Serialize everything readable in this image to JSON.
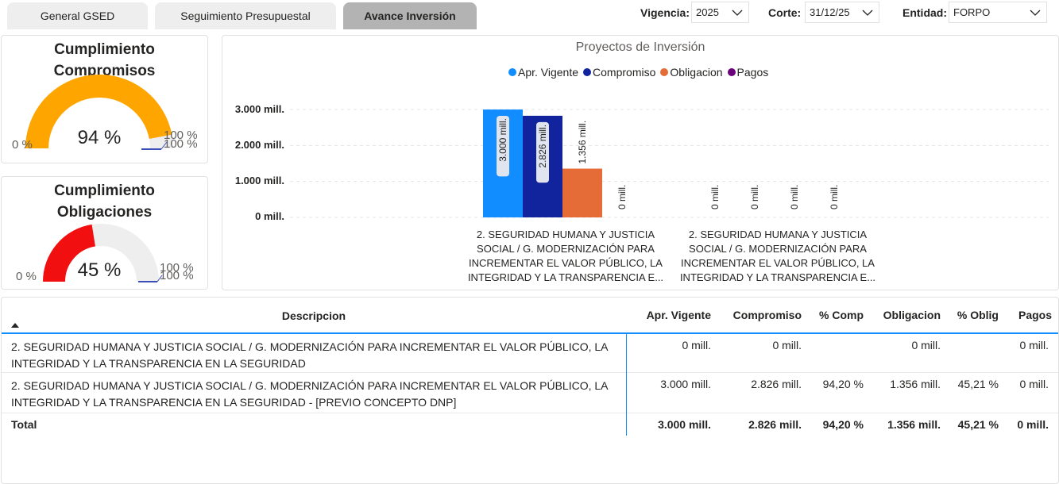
{
  "tabs": [
    {
      "label": "General GSED"
    },
    {
      "label": "Seguimiento Presupuestal"
    },
    {
      "label": "Avance Inversión"
    }
  ],
  "filters": {
    "vigencia": {
      "label": "Vigencia:",
      "value": "2025"
    },
    "corte": {
      "label": "Corte:",
      "value": "31/12/25"
    },
    "entidad": {
      "label": "Entidad:",
      "value": "FORPO"
    }
  },
  "gauges": [
    {
      "title_line1": "Cumplimiento",
      "title_line2": "Compromisos",
      "value_text": "94 %",
      "value": 0.94,
      "min_label": "0 %",
      "max_label": "100 %",
      "target_label": "100 %",
      "fill_color": "#FFA500"
    },
    {
      "title_line1": "Cumplimiento",
      "title_line2": "Obligaciones",
      "value_text": "45 %",
      "value": 0.45,
      "min_label": "0 %",
      "max_label": "100 %",
      "target_label": "100 %",
      "fill_color": "#F20F0F"
    }
  ],
  "chart_data": {
    "type": "bar",
    "title": "Proyectos de Inversión",
    "legend_position": "top-center",
    "grid": true,
    "ylim": [
      0,
      3000
    ],
    "yticks": [
      {
        "value": 0,
        "label": "0 mill."
      },
      {
        "value": 1000,
        "label": "1.000 mill."
      },
      {
        "value": 2000,
        "label": "2.000 mill."
      },
      {
        "value": 3000,
        "label": "3.000 mill."
      }
    ],
    "categories": [
      "2. SEGURIDAD HUMANA Y JUSTICIA SOCIAL / G. MODERNIZACIÓN PARA INCREMENTAR EL VALOR PÚBLICO, LA INTEGRIDAD Y LA TRANSPARENCIA E...",
      "2. SEGURIDAD HUMANA Y JUSTICIA SOCIAL / G. MODERNIZACIÓN PARA INCREMENTAR EL VALOR PÚBLICO, LA INTEGRIDAD Y LA TRANSPARENCIA E..."
    ],
    "series": [
      {
        "name": "Apr. Vigente",
        "color": "#118DFF",
        "values": [
          3000,
          0
        ],
        "labels": [
          "3.000 mill.",
          "0 mill."
        ]
      },
      {
        "name": "Compromiso",
        "color": "#12239E",
        "values": [
          2826,
          0
        ],
        "labels": [
          "2.826 mill.",
          "0 mill."
        ]
      },
      {
        "name": "Obligacion",
        "color": "#E66C37",
        "values": [
          1356,
          0
        ],
        "labels": [
          "1.356 mill.",
          "0 mill."
        ]
      },
      {
        "name": "Pagos",
        "color": "#6B007B",
        "values": [
          0,
          0
        ],
        "labels": [
          "0 mill.",
          "0 mill."
        ]
      }
    ]
  },
  "table": {
    "columns": [
      "Descripcion",
      "Apr. Vigente",
      "Compromiso",
      "% Comp",
      "Obligacion",
      "% Oblig",
      "Pagos"
    ],
    "rows": [
      {
        "desc_line1": "2. SEGURIDAD HUMANA Y JUSTICIA SOCIAL / G. MODERNIZACIÓN PARA INCREMENTAR EL VALOR PÚBLICO, LA",
        "desc_line2": "INTEGRIDAD Y LA TRANSPARENCIA EN LA SEGURIDAD",
        "apr": "0 mill.",
        "comp": "0 mill.",
        "pcomp": "",
        "oblig": "0 mill.",
        "poblig": "",
        "pagos": "0 mill."
      },
      {
        "desc_line1": "2. SEGURIDAD HUMANA Y JUSTICIA SOCIAL / G. MODERNIZACIÓN PARA INCREMENTAR EL VALOR PÚBLICO, LA",
        "desc_line2": "INTEGRIDAD Y LA TRANSPARENCIA EN LA SEGURIDAD - [PREVIO CONCEPTO DNP]",
        "apr": "3.000 mill.",
        "comp": "2.826 mill.",
        "pcomp": "94,20 %",
        "oblig": "1.356 mill.",
        "poblig": "45,21 %",
        "pagos": "0 mill."
      }
    ],
    "total": {
      "label": "Total",
      "apr": "3.000 mill.",
      "comp": "2.826 mill.",
      "pcomp": "94,20 %",
      "oblig": "1.356 mill.",
      "poblig": "45,21 %",
      "pagos": "0 mill."
    }
  }
}
